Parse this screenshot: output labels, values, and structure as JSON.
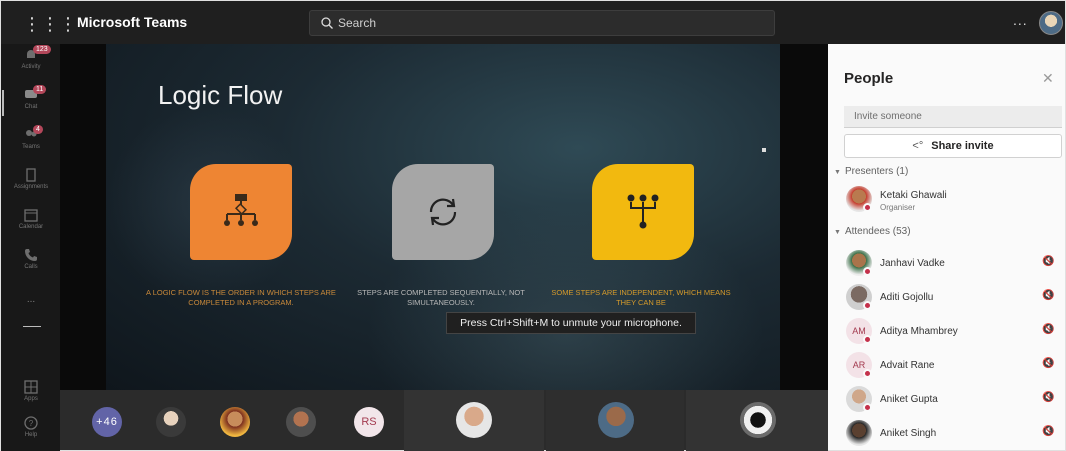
{
  "topbar": {
    "app_title": "Microsoft Teams",
    "search_placeholder": "Search",
    "more_label": "...",
    "icons": [
      "waffle-icon",
      "search-icon",
      "avatar"
    ]
  },
  "rail": {
    "items": [
      {
        "label": "Activity",
        "badge": "123",
        "icon": "bell-icon"
      },
      {
        "label": "Chat",
        "badge": "11",
        "icon": "chat-icon"
      },
      {
        "label": "Teams",
        "badge": "4",
        "icon": "teams-icon"
      },
      {
        "label": "Assignments",
        "icon": "assignments-icon"
      },
      {
        "label": "Calendar",
        "icon": "calendar-icon"
      },
      {
        "label": "Calls",
        "icon": "phone-icon"
      },
      {
        "label": "Apps",
        "icon": "apps-icon"
      },
      {
        "label": "Help",
        "icon": "help-icon"
      }
    ],
    "more_label": "..."
  },
  "slide": {
    "title": "Logic Flow",
    "captions": [
      "A LOGIC FLOW IS THE ORDER IN WHICH STEPS ARE COMPLETED IN A PROGRAM.",
      "STEPS ARE COMPLETED SEQUENTIALLY, NOT SIMULTANEOUSLY.",
      "SOME STEPS ARE INDEPENDENT, WHICH MEANS THEY CAN BE"
    ],
    "tile_colors": [
      "#ee8533",
      "#a6a6a6",
      "#f2b90f"
    ]
  },
  "toast": "Press Ctrl+Shift+M to unmute your microphone.",
  "strip": {
    "overflow_count": "+46",
    "initials": "RS"
  },
  "people": {
    "title": "People",
    "invite_placeholder": "Invite someone",
    "share_label": "Share invite",
    "presenters_header": "Presenters (1)",
    "attendees_header": "Attendees (53)",
    "presenters": [
      {
        "name": "Ketaki Ghawali",
        "role": "Organiser"
      }
    ],
    "attendees": [
      {
        "name": "Janhavi Vadke",
        "initials": ""
      },
      {
        "name": "Aditi Gojollu",
        "initials": ""
      },
      {
        "name": "Aditya Mhambrey",
        "initials": "AM"
      },
      {
        "name": "Advait Rane",
        "initials": "AR"
      },
      {
        "name": "Aniket Gupta",
        "initials": ""
      },
      {
        "name": "Aniket Singh",
        "initials": ""
      }
    ]
  },
  "colors": {
    "accent": "#6264a7",
    "status_busy": "#c4314b",
    "topbar": "#1f1f1f"
  }
}
